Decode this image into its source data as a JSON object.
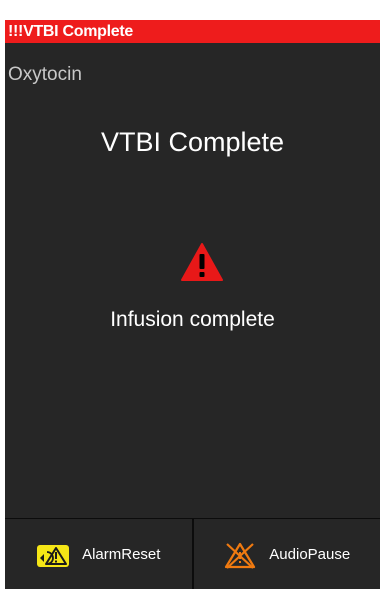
{
  "alarm_banner": {
    "text": "!!!VTBI Complete",
    "color": "#ee1c1c"
  },
  "drug_name": "Oxytocin",
  "screen": {
    "title": "VTBI Complete",
    "icon": "warning-triangle-icon",
    "message": "Infusion complete"
  },
  "buttons": {
    "alarm_reset": {
      "label": "AlarmReset",
      "icon": "alarm-reset-icon",
      "icon_color": "#f5e616"
    },
    "audio_pause": {
      "label": "AudioPause",
      "icon": "audio-pause-icon",
      "icon_color": "#f07a10"
    }
  }
}
